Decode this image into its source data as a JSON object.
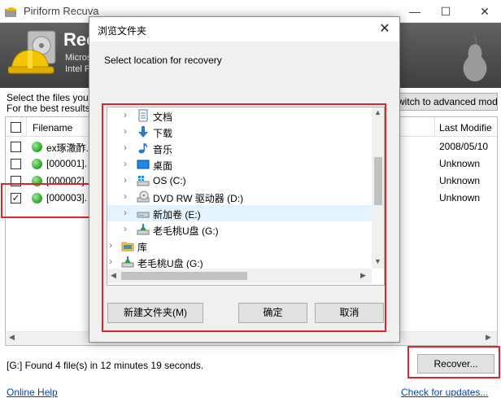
{
  "window": {
    "title": "Piriform Recuva",
    "minimize": "—",
    "maximize": "☐",
    "close": "✕"
  },
  "header": {
    "app_name": "Recu",
    "sub_line1": "Micros",
    "sub_line2": "Intel F"
  },
  "info": {
    "line1": "Select the files you w",
    "line2": "For the best results, r"
  },
  "advanced_button": "witch to advanced mode",
  "file_list": {
    "columns": {
      "filename": "Filename",
      "last_modified": "Last Modifie"
    },
    "rows": [
      {
        "name": "ex琢潵酢.",
        "date": "2008/05/10",
        "checked": false
      },
      {
        "name": "[000001].",
        "date": "Unknown",
        "checked": false
      },
      {
        "name": "[000002].",
        "date": "Unknown",
        "checked": false
      },
      {
        "name": "[000003].",
        "date": "Unknown",
        "checked": true
      }
    ]
  },
  "status": "[G:] Found 4 file(s) in 12 minutes 19 seconds.",
  "recover_button": "Recover...",
  "links": {
    "online_help": "Online Help",
    "check_updates": "Check for updates..."
  },
  "dialog": {
    "title": "浏览文件夹",
    "close": "✕",
    "prompt": "Select location for recovery",
    "tree": [
      {
        "label": "文档",
        "icon": "documents-icon"
      },
      {
        "label": "下载",
        "icon": "download-icon"
      },
      {
        "label": "音乐",
        "icon": "music-icon"
      },
      {
        "label": "桌面",
        "icon": "desktop-icon"
      },
      {
        "label": "OS (C:)",
        "icon": "windows-drive-icon"
      },
      {
        "label": "DVD RW 驱动器 (D:)",
        "icon": "dvd-drive-icon"
      },
      {
        "label": "新加卷 (E:)",
        "icon": "drive-icon",
        "selected": true
      },
      {
        "label": "老毛桃U盘 (G:)",
        "icon": "usb-drive-icon"
      },
      {
        "label": "库",
        "icon": "library-icon"
      },
      {
        "label": "老毛桃U盘 (G:)",
        "icon": "usb-drive-icon"
      }
    ],
    "buttons": {
      "new_folder": "新建文件夹(M)",
      "ok": "确定",
      "cancel": "取消"
    }
  },
  "colors": {
    "highlight_red": "#e0242b",
    "selection": "#e5f3ff",
    "link": "#0645ad"
  }
}
